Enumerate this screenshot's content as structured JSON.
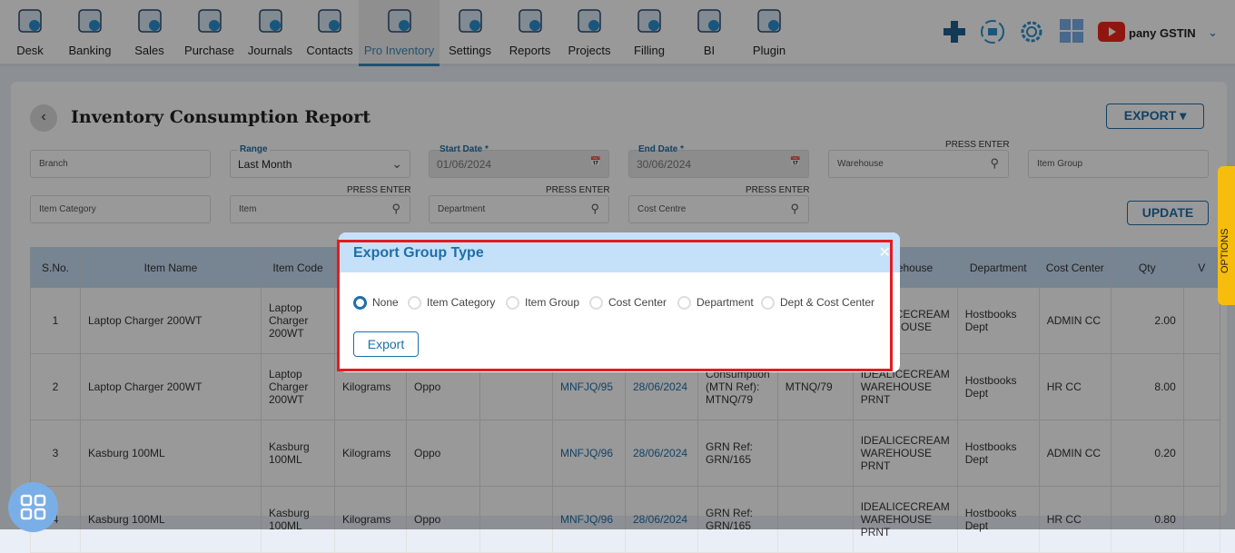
{
  "nav": {
    "items": [
      {
        "label": "Desk",
        "icon": "desk-icon"
      },
      {
        "label": "Banking",
        "icon": "bank-icon"
      },
      {
        "label": "Sales",
        "icon": "sales-icon"
      },
      {
        "label": "Purchase",
        "icon": "purchase-icon"
      },
      {
        "label": "Journals",
        "icon": "journals-icon"
      },
      {
        "label": "Contacts",
        "icon": "contacts-icon"
      },
      {
        "label": "Pro Inventory",
        "icon": "inventory-icon",
        "active": true
      },
      {
        "label": "Settings",
        "icon": "settings-tools-icon"
      },
      {
        "label": "Reports",
        "icon": "reports-icon"
      },
      {
        "label": "Projects",
        "icon": "projects-icon"
      },
      {
        "label": "Filling",
        "icon": "filling-icon"
      },
      {
        "label": "BI",
        "icon": "bi-icon"
      },
      {
        "label": "Plugin",
        "icon": "plugin-icon"
      }
    ],
    "company": "pany GSTIN"
  },
  "page": {
    "title": "Inventory Consumption Report",
    "export_label": "EXPORT",
    "update_label": "UPDATE",
    "options_label": "OPTIONS"
  },
  "filters": {
    "branch": "Branch",
    "range_label": "Range",
    "range_value": "Last Month",
    "start_label": "Start Date *",
    "start_value": "01/06/2024",
    "end_label": "End Date *",
    "end_value": "30/06/2024",
    "warehouse": "Warehouse",
    "item_group": "Item Group",
    "item_category": "Item Category",
    "item": "Item",
    "department": "Department",
    "cost_centre": "Cost Centre",
    "press_enter": "PRESS ENTER"
  },
  "table": {
    "headers": [
      "S.No.",
      "Item Name",
      "Item Code",
      "",
      "",
      "",
      "",
      "",
      "",
      "",
      "Warehouse",
      "Department",
      "Cost Center",
      "Qty",
      "V"
    ],
    "rows": [
      [
        "1",
        "Laptop Charger 200WT",
        "Laptop Charger 200WT",
        "",
        "",
        "",
        "",
        "",
        "",
        "",
        "IDEALICECREAM WAREHOUSE",
        "Hostbooks Dept",
        "ADMIN CC",
        "2.00",
        ""
      ],
      [
        "2",
        "Laptop Charger 200WT",
        "Laptop Charger 200WT",
        "Kilograms",
        "Oppo",
        "",
        "MNFJQ/95",
        "28/06/2024",
        "Consumption (MTN Ref): MTNQ/79",
        "MTNQ/79",
        "IDEALICECREAM WAREHOUSE PRNT",
        "Hostbooks Dept",
        "HR CC",
        "8.00",
        ""
      ],
      [
        "3",
        "Kasburg 100ML",
        "Kasburg 100ML",
        "Kilograms",
        "Oppo",
        "",
        "MNFJQ/96",
        "28/06/2024",
        "GRN Ref: GRN/165",
        "",
        "IDEALICECREAM WAREHOUSE PRNT",
        "Hostbooks Dept",
        "ADMIN CC",
        "0.20",
        ""
      ],
      [
        "4",
        "Kasburg 100ML",
        "Kasburg 100ML",
        "Kilograms",
        "Oppo",
        "",
        "MNFJQ/96",
        "28/06/2024",
        "GRN Ref: GRN/165",
        "",
        "IDEALICECREAM WAREHOUSE PRNT",
        "Hostbooks Dept",
        "HR CC",
        "0.80",
        ""
      ]
    ]
  },
  "modal": {
    "title": "Export Group Type",
    "options": [
      "None",
      "Item Category",
      "Item Group",
      "Cost Center",
      "Department",
      "Dept & Cost Center"
    ],
    "selected": "None",
    "export_label": "Export"
  },
  "colors": {
    "accent": "#1e6fa8",
    "highlight": "#e41b23",
    "options_tab": "#f7bd0d"
  }
}
